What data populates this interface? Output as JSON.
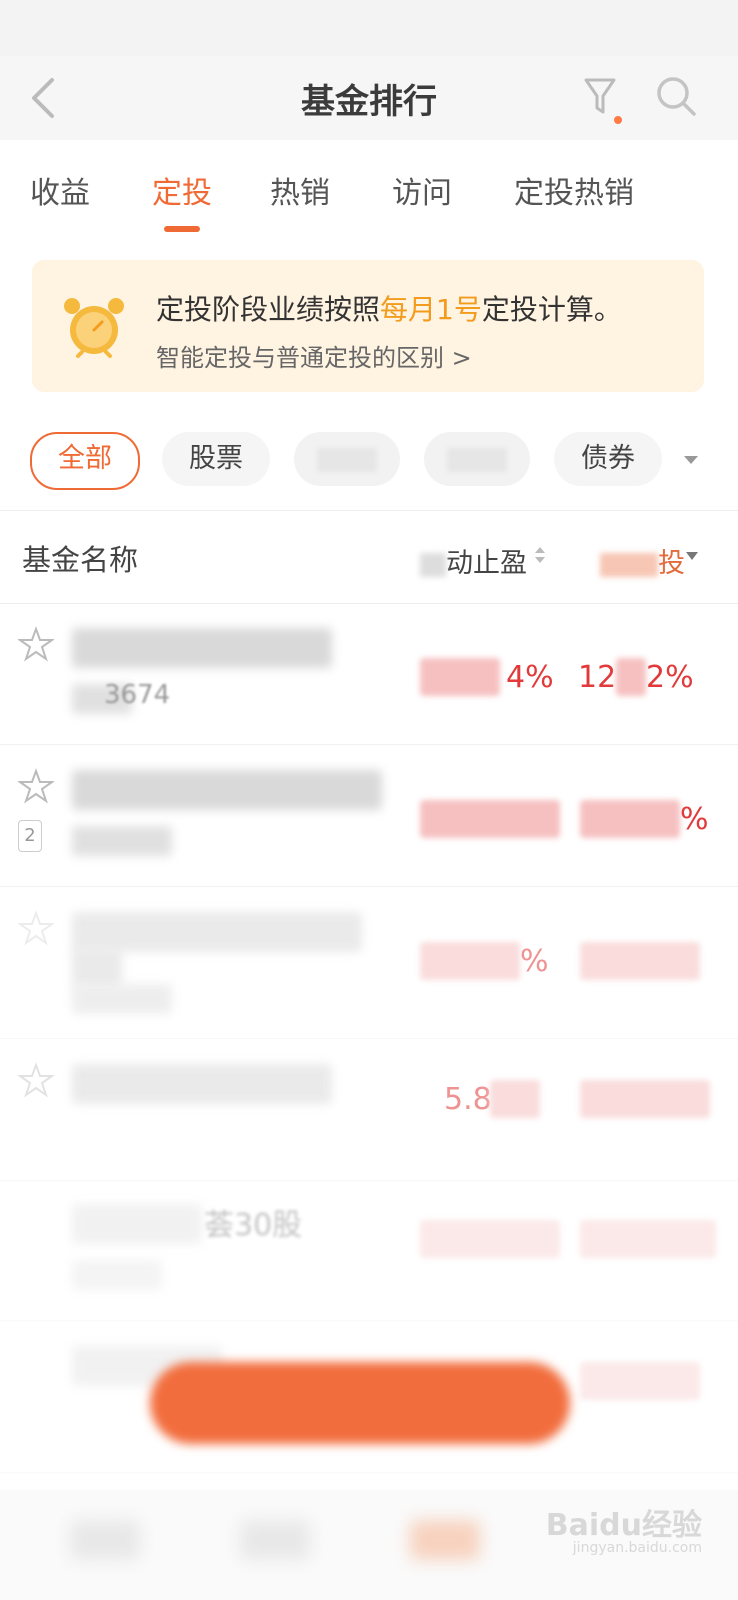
{
  "nav": {
    "title": "基金排行"
  },
  "tabs": [
    {
      "label": "收益"
    },
    {
      "label": "定投",
      "active": true
    },
    {
      "label": "热销"
    },
    {
      "label": "访问"
    },
    {
      "label": "定投热销"
    }
  ],
  "notice": {
    "text_before": "定投阶段业绩按照",
    "highlight": "每月1号",
    "text_after": "定投计算。",
    "link": "智能定投与普通定投的区别 >"
  },
  "filters": [
    {
      "label": "全部",
      "active": true
    },
    {
      "label": "股票"
    },
    {
      "label": "债券"
    }
  ],
  "table": {
    "header_name": "基金名称",
    "header_col1": "动止盈",
    "header_col2": "投",
    "rows": [
      {
        "code_partial": "3674",
        "val1_partial": "4%",
        "val2_partial": "12",
        "val2_partial_b": "2%"
      },
      {
        "badge": "2",
        "val2_partial": "%"
      },
      {
        "val1_partial": "%"
      },
      {
        "val1_partial": "5.8"
      },
      {
        "name_partial": "荟30股"
      }
    ]
  },
  "colors": {
    "accent": "#f06a35",
    "highlight": "#f29b1d",
    "positive": "#e23a3a",
    "notice_bg": "#fff3e2"
  },
  "watermark": {
    "text": "Baidu经验",
    "sub": "jingyan.baidu.com"
  }
}
